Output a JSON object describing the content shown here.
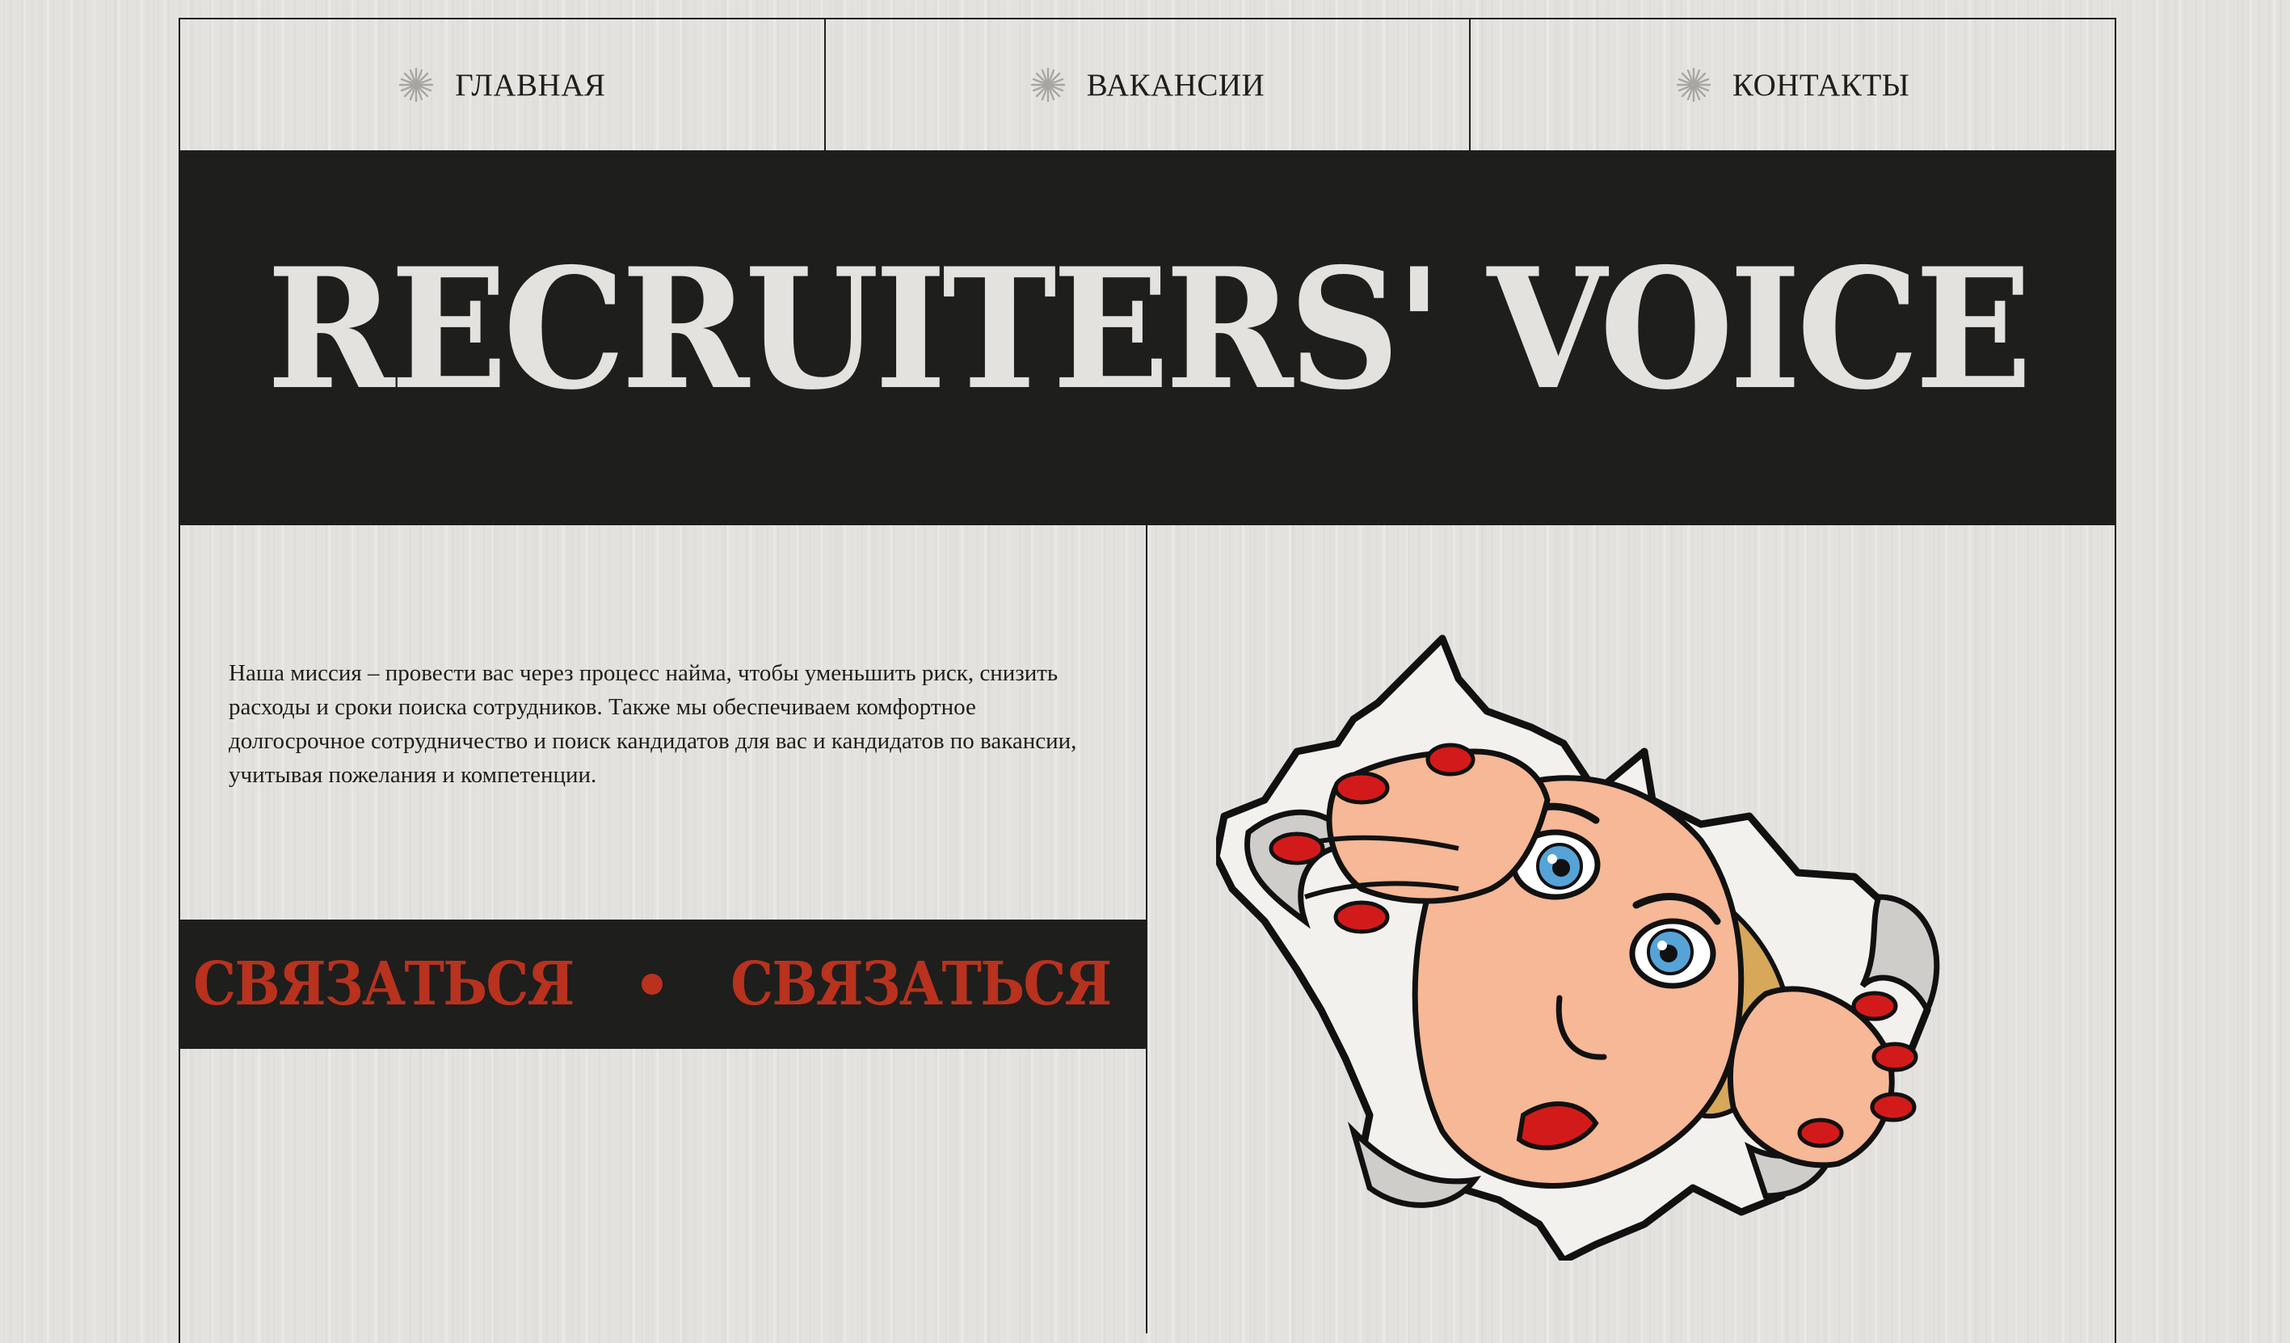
{
  "nav": {
    "items": [
      {
        "label": "ГЛАВНАЯ",
        "icon": "star-icon"
      },
      {
        "label": "ВАКАНСИИ",
        "icon": "star-icon"
      },
      {
        "label": "КОНТАКТЫ",
        "icon": "star-icon"
      }
    ]
  },
  "hero": {
    "title": "RECRUITERS' VOICE"
  },
  "mission": {
    "text": "Наша миссия – провести вас через процесс найма, чтобы уменьшить риск, снизить расходы и сроки поиска сотрудников. Также мы обеспечиваем комфортное долгосрочное сотрудничество и поиск кандидатов для вас и кандидатов по вакансии, учитывая пожелания и компетенции."
  },
  "ticker": {
    "label": "СВЯЗАТЬСЯ"
  },
  "illustration": {
    "icon": "peeking-woman-illustration"
  },
  "colors": {
    "background": "#e4e2de",
    "dark": "#1e1e1c",
    "accent": "#b8321e"
  }
}
